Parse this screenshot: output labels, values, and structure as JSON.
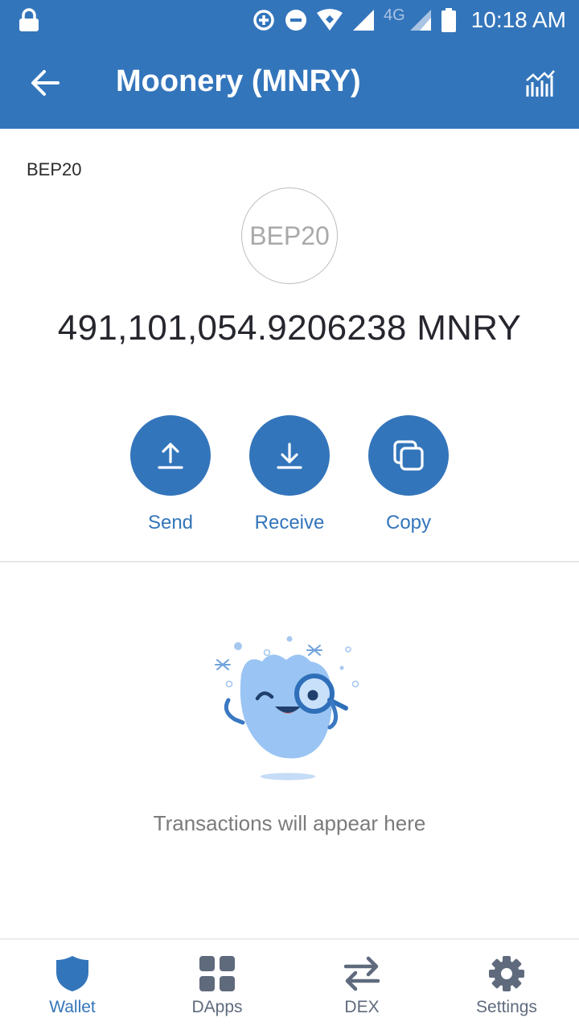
{
  "status_bar": {
    "network": "4G",
    "time": "10:18 AM",
    "icons": [
      "lock-icon",
      "data-saver-icon",
      "dnd-icon",
      "wifi-icon",
      "signal-icon",
      "signal-4g-icon",
      "battery-icon"
    ]
  },
  "header": {
    "title": "Moonery (MNRY)",
    "back_icon": "arrow-left-icon",
    "chart_icon": "chart-icon"
  },
  "token": {
    "network_label": "BEP20",
    "logo_text": "BEP20",
    "balance": "491,101,054.9206238 MNRY"
  },
  "actions": [
    {
      "label": "Send",
      "icon": "upload-icon"
    },
    {
      "label": "Receive",
      "icon": "download-icon"
    },
    {
      "label": "Copy",
      "icon": "copy-icon"
    }
  ],
  "empty_state": {
    "text": "Transactions will appear here",
    "illustration": "searching-mascot"
  },
  "bottom_nav": [
    {
      "label": "Wallet",
      "icon": "shield-icon",
      "active": true
    },
    {
      "label": "DApps",
      "icon": "grid-icon",
      "active": false
    },
    {
      "label": "DEX",
      "icon": "swap-icon",
      "active": false
    },
    {
      "label": "Settings",
      "icon": "gear-icon",
      "active": false
    }
  ],
  "colors": {
    "primary": "#3375bb",
    "text_dark": "#26272e",
    "text_muted": "#7b7b7b",
    "nav_inactive": "#5f6a7d"
  }
}
